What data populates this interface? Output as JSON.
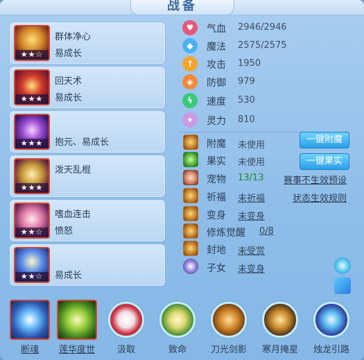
{
  "title": "战备",
  "skills": [
    {
      "name": "群体净心",
      "sub": "易成长",
      "stars": "★★☆"
    },
    {
      "name": "回天术",
      "sub": "易成长",
      "stars": "★★★"
    },
    {
      "name": "",
      "sub": "抱元、易成长",
      "stars": "★★★"
    },
    {
      "name": "泼天乱棍",
      "sub": "",
      "stars": "★★★"
    },
    {
      "name": "嗜血连击",
      "sub": "愤怒",
      "stars": "★★☆"
    },
    {
      "name": "",
      "sub": "易成长",
      "stars": "★★☆"
    }
  ],
  "attributes": [
    {
      "label": "气血",
      "value": "2946/2946",
      "icon": "heart-icon",
      "color": "#e8587a"
    },
    {
      "label": "魔法",
      "value": "2575/2575",
      "icon": "mana-icon",
      "color": "#4ab2f2"
    },
    {
      "label": "攻击",
      "value": "1950",
      "icon": "attack-icon",
      "color": "#f2a630"
    },
    {
      "label": "防御",
      "value": "979",
      "icon": "defense-icon",
      "color": "#ef8a3a"
    },
    {
      "label": "速度",
      "value": "530",
      "icon": "speed-icon",
      "color": "#3ac87a"
    },
    {
      "label": "灵力",
      "value": "810",
      "icon": "spirit-icon",
      "color": "#c99ae6"
    }
  ],
  "status": {
    "enchant": {
      "label": "附魔",
      "value": "未使用"
    },
    "fruit": {
      "label": "果实",
      "value": "未使用"
    },
    "pet": {
      "label": "宠物",
      "value": "13/13"
    },
    "blessing": {
      "label": "祈福",
      "value": "未祈福"
    },
    "transform": {
      "label": "变身",
      "value": "未变身"
    },
    "cultivation": {
      "label": "修炼觉醒",
      "value": "0/8"
    },
    "fief": {
      "label": "封地",
      "value": "未受赏"
    },
    "children": {
      "label": "子女",
      "value": "未变身"
    }
  },
  "buttons": {
    "enchant": "一键附魔",
    "fruit": "一键果实"
  },
  "links": {
    "tournament": "赛事不生效预设",
    "rule": "状态生效规则"
  },
  "bottom_skills": [
    {
      "label": "断魂",
      "underline": true
    },
    {
      "label": "莲华度世",
      "underline": true
    },
    {
      "label": "汲取",
      "underline": false
    },
    {
      "label": "致命",
      "underline": false
    },
    {
      "label": "刀光剑影",
      "underline": false
    },
    {
      "label": "寒月掩星",
      "underline": false
    },
    {
      "label": "烛龙引路",
      "underline": false
    }
  ]
}
